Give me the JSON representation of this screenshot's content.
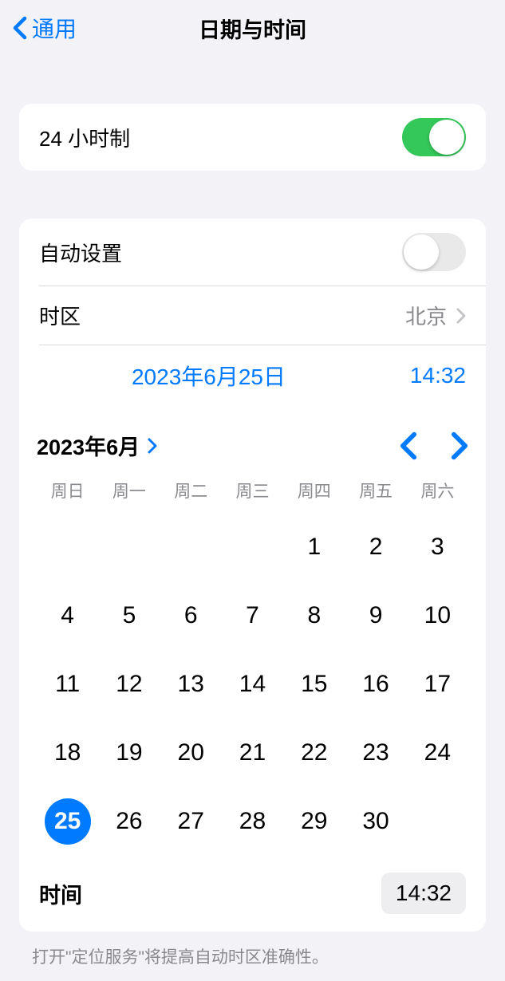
{
  "header": {
    "back_label": "通用",
    "title": "日期与时间"
  },
  "twentyfour_hour": {
    "label": "24 小时制",
    "on": true
  },
  "auto_set": {
    "label": "自动设置",
    "on": false
  },
  "timezone": {
    "label": "时区",
    "value": "北京"
  },
  "datetime": {
    "date": "2023年6月25日",
    "time": "14:32"
  },
  "calendar": {
    "month_label": "2023年6月",
    "weekdays": [
      "周日",
      "周一",
      "周二",
      "周三",
      "周四",
      "周五",
      "周六"
    ],
    "leading_blanks": 4,
    "days": [
      1,
      2,
      3,
      4,
      5,
      6,
      7,
      8,
      9,
      10,
      11,
      12,
      13,
      14,
      15,
      16,
      17,
      18,
      19,
      20,
      21,
      22,
      23,
      24,
      25,
      26,
      27,
      28,
      29,
      30
    ],
    "selected_day": 25
  },
  "time": {
    "label": "时间",
    "value": "14:32"
  },
  "footer": {
    "text": "打开\"定位服务\"将提高自动时区准确性。"
  }
}
